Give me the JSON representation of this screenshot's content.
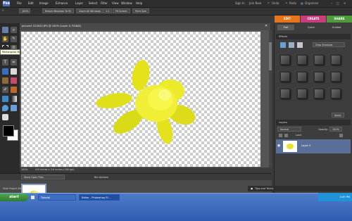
{
  "menubar": {
    "items": [
      "File",
      "Edit",
      "Image",
      "Enhance",
      "Layer",
      "Select",
      "Filter",
      "View",
      "Window",
      "Help"
    ],
    "right": {
      "sign_in": "Sign In",
      "join_now": "Join Now",
      "undo": "Undo",
      "redo": "Redo",
      "organizer": "Organizer"
    }
  },
  "options": {
    "zoom": "100%",
    "resize_windows": "Resize Windows To Fit",
    "zoom_all": "Zoom All Windows",
    "actual_pixels": "1:1",
    "fit_screen": "Fit Screen",
    "print_size": "Print Size"
  },
  "modes": {
    "edit": "EDIT",
    "create": "CREATE",
    "share": "SHARE"
  },
  "colors": {
    "edit": "#e5741a",
    "create": "#c63e7e",
    "share": "#4f9a3a"
  },
  "tooltip": "Rectangular Marquee Tool (M)",
  "document": {
    "title": "picture1 013022.JPG @ 100% (Layer 0, RGB/8)",
    "zoom": "100%",
    "dimensions": "4.8 inches x 3.6 inches (180 ppi)"
  },
  "bin": {
    "label": "Show Open Files",
    "actions": "Bin Actions"
  },
  "panel": {
    "tabs": [
      "Full",
      "Quick",
      "Guided"
    ],
    "effects_title": "Effects",
    "effects_filter": "Drop Shadows",
    "apply": "Apply",
    "layers_title": "Layers",
    "blend_mode": "Normal",
    "opacity_label": "Opacity:",
    "opacity_value": "100%",
    "lock_label": "Lock:",
    "layer_name": "Layer 0"
  },
  "hide_bin": "Hide Project Bin",
  "tips": "Tips and Tricks",
  "taskbar": {
    "start": "start",
    "tasks": [
      "Tutorial",
      "Editor - Photoshop El..."
    ],
    "clock": "3:09 PM"
  }
}
